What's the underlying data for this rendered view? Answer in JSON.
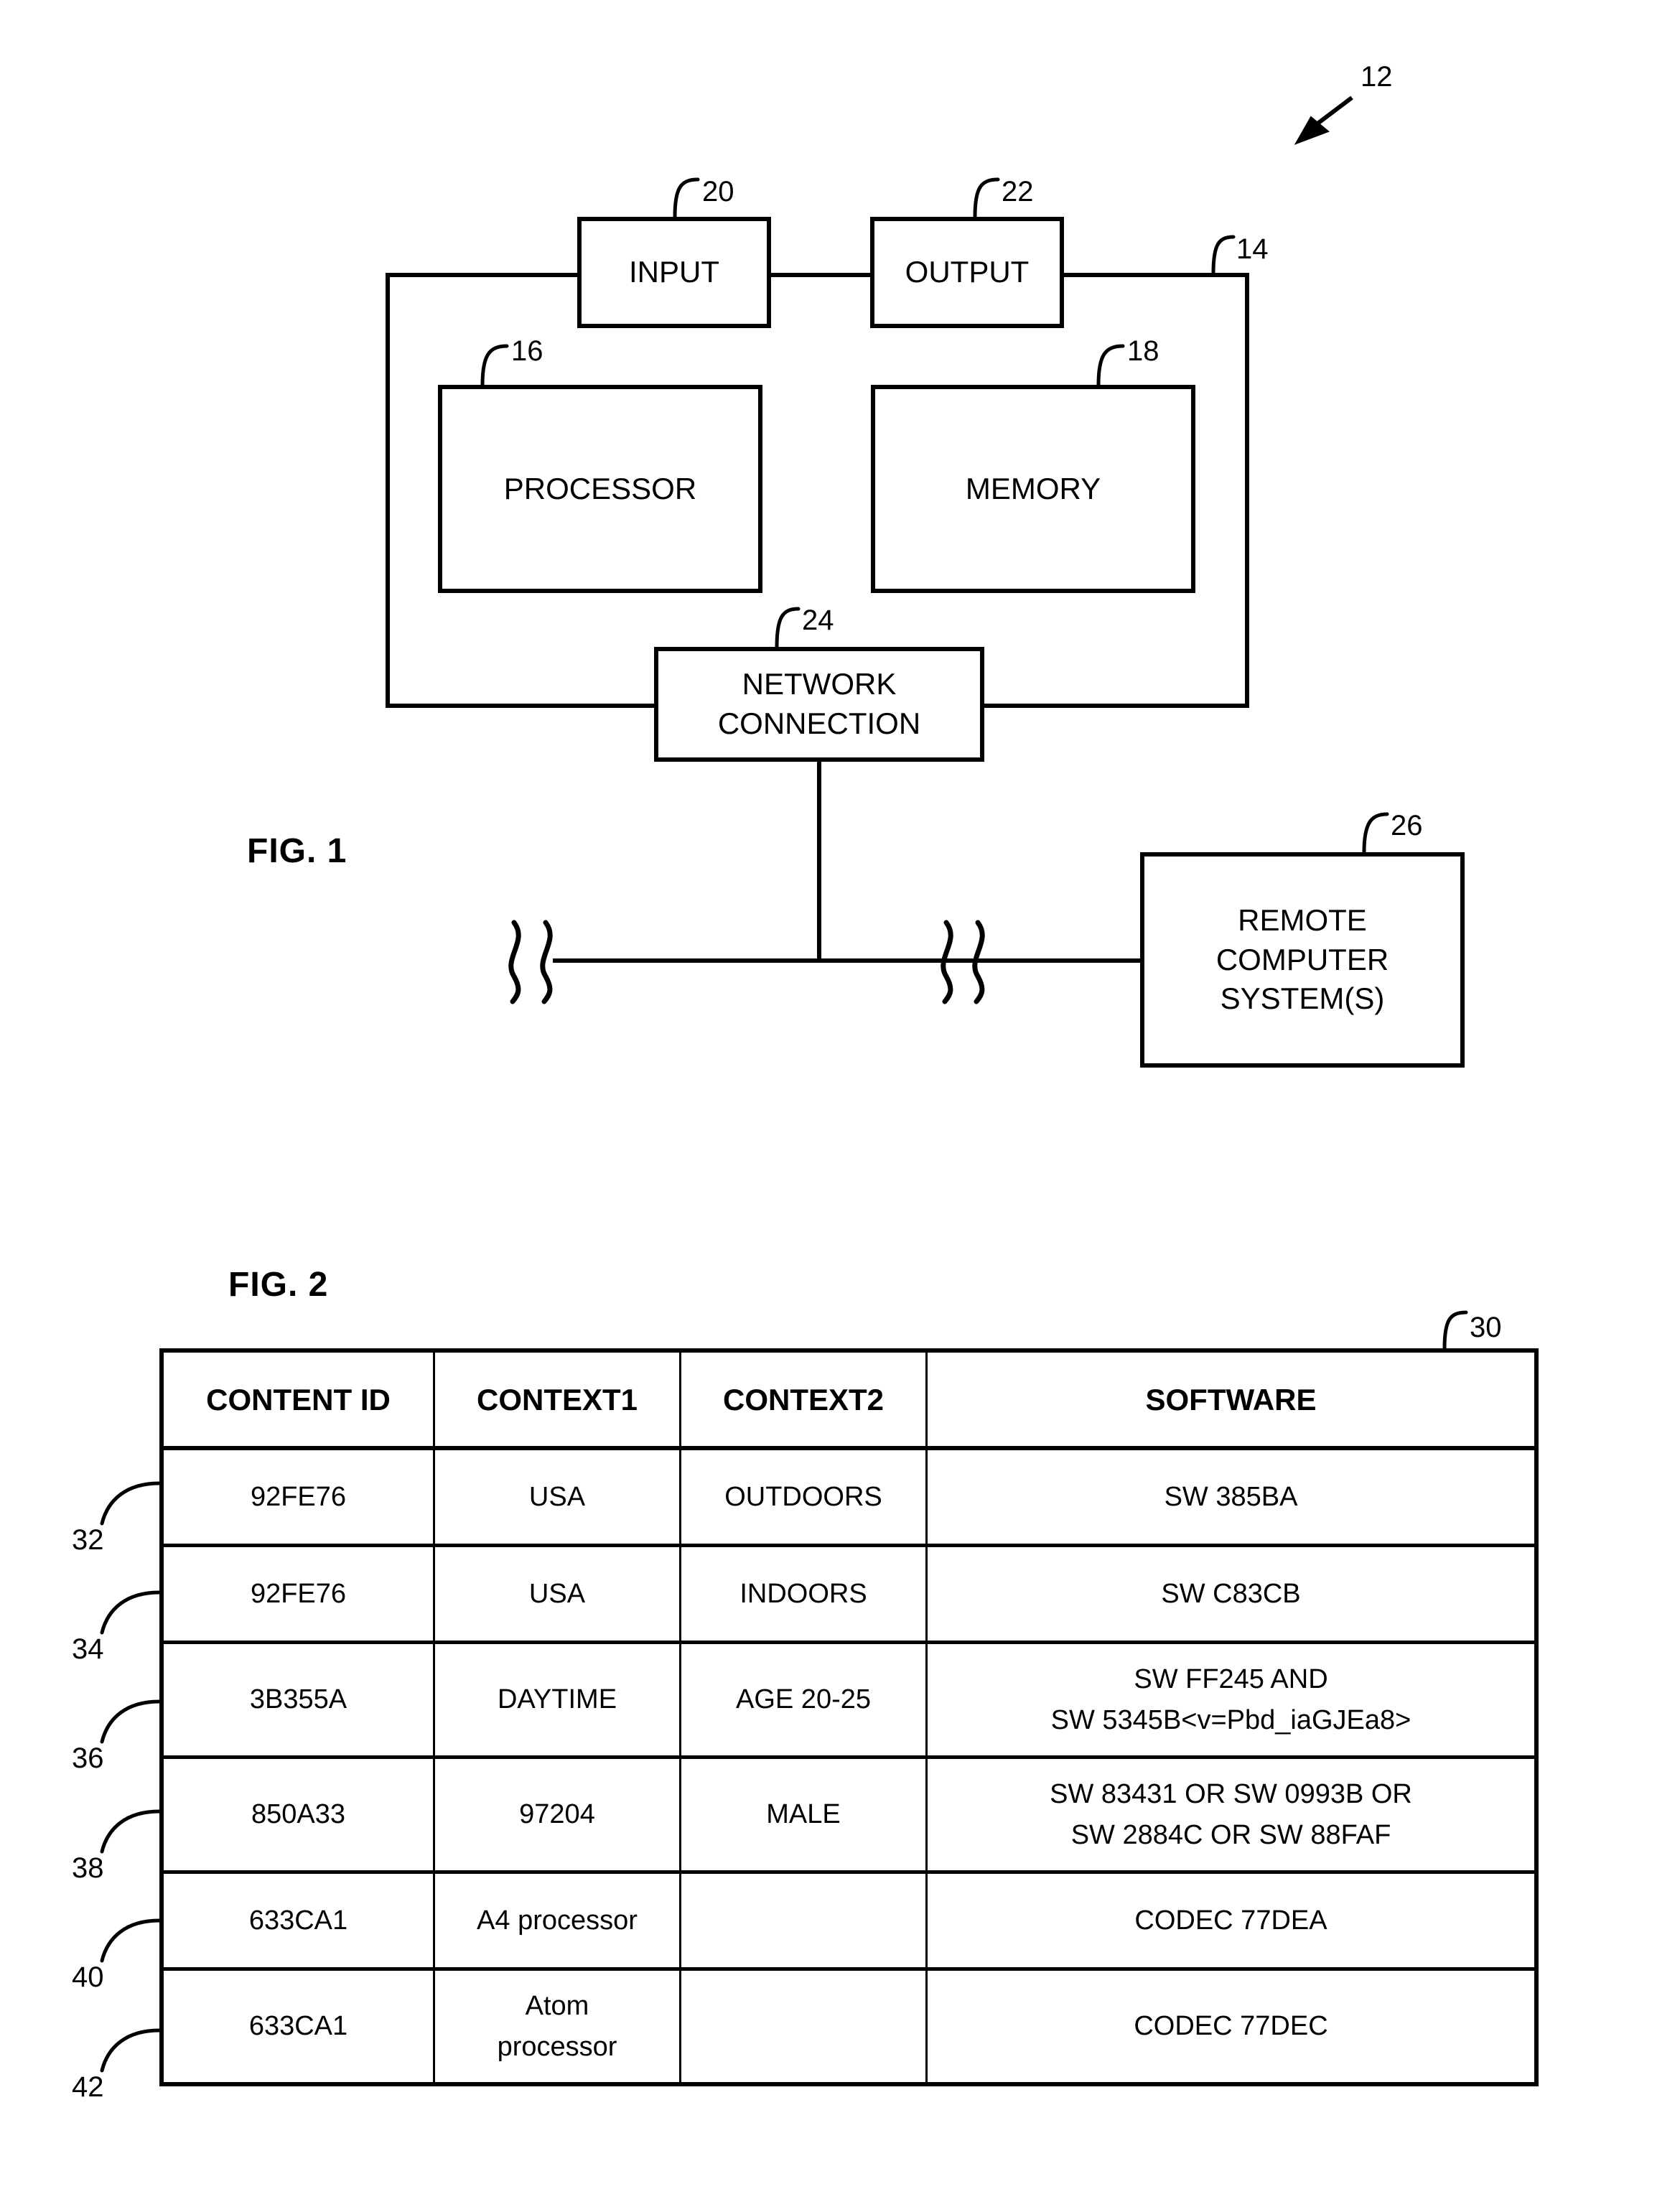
{
  "figure1": {
    "caption": "FIG. 1",
    "system_ref": "12",
    "enclosure_ref": "14",
    "blocks": {
      "input": {
        "label": "INPUT",
        "ref": "20"
      },
      "output": {
        "label": "OUTPUT",
        "ref": "22"
      },
      "processor": {
        "label": "PROCESSOR",
        "ref": "16"
      },
      "memory": {
        "label": "MEMORY",
        "ref": "18"
      },
      "network_connection": {
        "line1": "NETWORK",
        "line2": "CONNECTION",
        "ref": "24"
      },
      "remote": {
        "line1": "REMOTE",
        "line2": "COMPUTER",
        "line3": "SYSTEM(S)",
        "ref": "26"
      }
    }
  },
  "figure2": {
    "caption": "FIG. 2",
    "table_ref": "30",
    "row_refs": [
      "32",
      "34",
      "36",
      "38",
      "40",
      "42"
    ],
    "columns": [
      "CONTENT ID",
      "CONTEXT1",
      "CONTEXT2",
      "SOFTWARE"
    ],
    "rows": [
      {
        "content_id": "92FE76",
        "context1": "USA",
        "context2": "OUTDOORS",
        "software_l1": "SW 385BA",
        "software_l2": ""
      },
      {
        "content_id": "92FE76",
        "context1": "USA",
        "context2": "INDOORS",
        "software_l1": "SW C83CB",
        "software_l2": ""
      },
      {
        "content_id": "3B355A",
        "context1": "DAYTIME",
        "context2": "AGE 20-25",
        "software_l1": "SW FF245 AND",
        "software_l2": "SW 5345B<v=Pbd_iaGJEa8>"
      },
      {
        "content_id": "850A33",
        "context1": "97204",
        "context2": "MALE",
        "software_l1": "SW 83431 OR SW 0993B OR",
        "software_l2": "SW 2884C OR SW 88FAF"
      },
      {
        "content_id": "633CA1",
        "context1": "A4 processor",
        "context2": "",
        "software_l1": "CODEC 77DEA",
        "software_l2": ""
      },
      {
        "content_id": "633CA1",
        "context1_l1": "Atom",
        "context1_l2": "processor",
        "context1": "",
        "context2": "",
        "software_l1": "CODEC 77DEC",
        "software_l2": ""
      }
    ]
  }
}
